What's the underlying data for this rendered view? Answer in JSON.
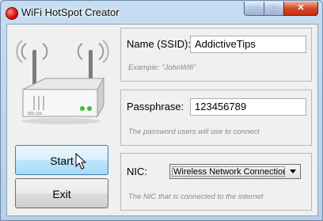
{
  "window": {
    "title": "WiFi HotSpot Creator",
    "minimize_glyph": "—",
    "maximize_glyph": "□",
    "close_glyph": "✕"
  },
  "router_image": {
    "icon": "wireless-router-icon",
    "model_text": "802.11b"
  },
  "buttons": {
    "start": "Start",
    "exit": "Exit"
  },
  "ssid": {
    "label": "Name (SSID):",
    "value": "AddictiveTips",
    "hint": "Example: \"JohnWifi\""
  },
  "passphrase": {
    "label": "Passphrase:",
    "value": "123456789",
    "hint": "The password users will use to connect"
  },
  "nic": {
    "label": "NIC:",
    "selected": "Wireless Network Connection",
    "hint": "The NIC that is connected to the internet"
  },
  "colors": {
    "start_button": "#bee6fd",
    "close_button": "#c22f12",
    "window_frame": "#c6dcf1"
  }
}
